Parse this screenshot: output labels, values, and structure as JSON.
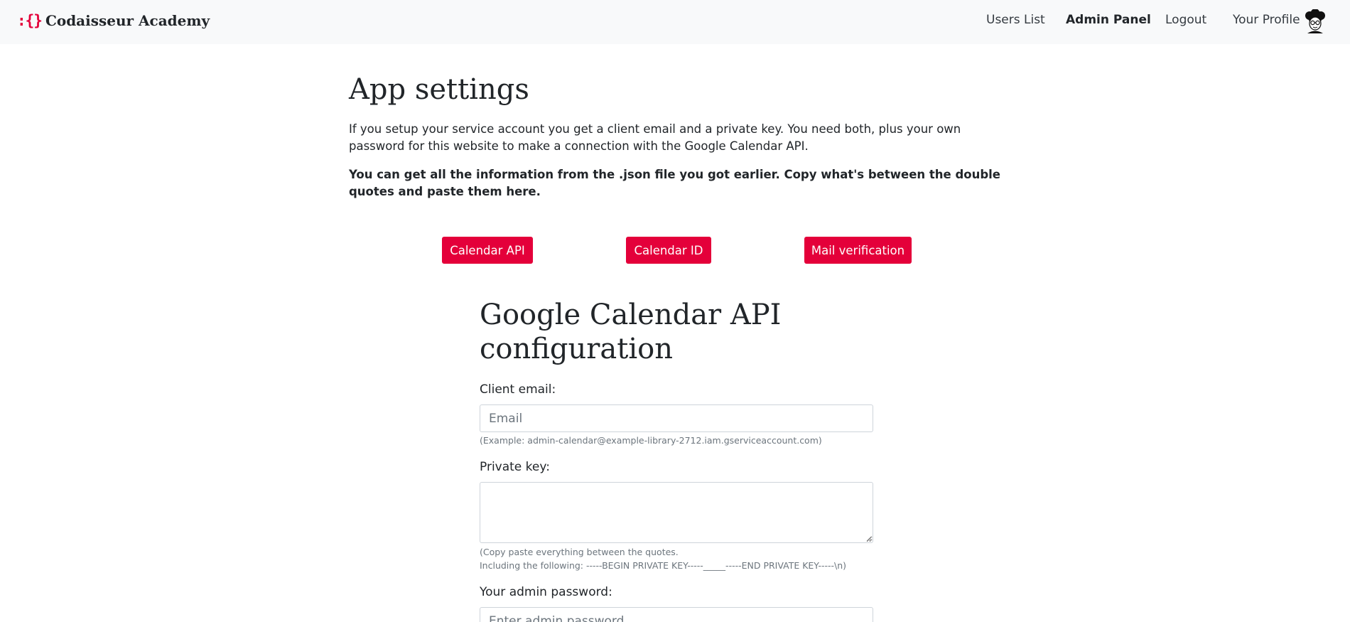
{
  "navbar": {
    "brand_logo": ":{}",
    "brand_name": "Codaisseur Academy",
    "links": {
      "users_list": "Users List",
      "admin_panel": "Admin Panel",
      "logout": "Logout",
      "your_profile": "Your Profile"
    },
    "avatar_icon": "profile-avatar-icon"
  },
  "main": {
    "title": "App settings",
    "intro": "If you setup your service account you get a client email and a private key. You need both, plus your own password for this website to make a connection with the Google Calendar API.",
    "intro_bold": "You can get all the information from the .json file you got earlier. Copy what's between the double quotes and paste them here.",
    "tabs": {
      "calendar_api": "Calendar API",
      "calendar_id": "Calendar ID",
      "mail_verification": "Mail verification"
    }
  },
  "form": {
    "title": "Google Calendar API configuration",
    "client_email": {
      "label": "Client email:",
      "placeholder": "Email",
      "value": "",
      "hint": "(Example: admin-calendar@example-library-2712.iam.gserviceaccount.com)"
    },
    "private_key": {
      "label": "Private key:",
      "value": "",
      "hint_line1": "(Copy paste everything between the quotes.",
      "hint_line2": "Including the following: -----BEGIN PRIVATE KEY-----_____-----END PRIVATE KEY-----\\n)"
    },
    "admin_password": {
      "label": "Your admin password:",
      "placeholder": "Enter admin password",
      "value": ""
    }
  },
  "colors": {
    "accent": "#e4003a",
    "navbar_bg": "#f8f9fa",
    "text": "#212529",
    "muted": "#6c757d"
  }
}
